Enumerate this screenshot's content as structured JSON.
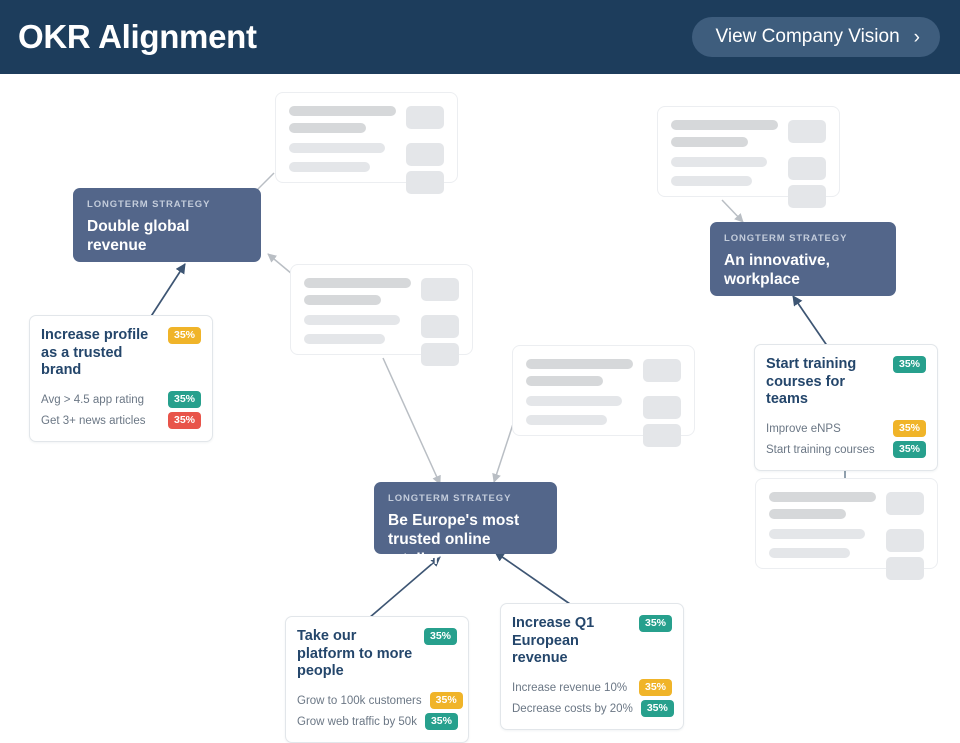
{
  "header": {
    "title": "OKR Alignment",
    "vision_button_label": "View Company Vision",
    "chevron": "›",
    "background": "#1d3d5c",
    "button_background": "#3e5d7d"
  },
  "colors": {
    "strategy_card": "#53668a",
    "okr_title": "#24466b",
    "badge_teal": "#27a08d",
    "badge_amber": "#f0b429",
    "badge_red": "#e8544a",
    "connector_grey": "#b9bec4",
    "connector_navy": "#3d5573"
  },
  "strategy_kicker": "LONGTERM STRATEGY",
  "strategies": [
    {
      "kicker": "LONGTERM STRATEGY",
      "title": "Double global revenue"
    },
    {
      "kicker": "LONGTERM STRATEGY",
      "title": "Be Europe's most trusted online retailer"
    },
    {
      "kicker": "LONGTERM STRATEGY",
      "title": "An innovative, workplace"
    }
  ],
  "okrs": [
    {
      "title": "Increase profile as a trusted brand",
      "progress": "35%",
      "progress_color": "amber",
      "key_results": [
        {
          "label": "Avg > 4.5 app rating",
          "progress": "35%",
          "color": "teal"
        },
        {
          "label": "Get 3+ news articles",
          "progress": "35%",
          "color": "red"
        }
      ]
    },
    {
      "title": "Start training courses for teams",
      "progress": "35%",
      "progress_color": "teal",
      "key_results": [
        {
          "label": "Improve eNPS",
          "progress": "35%",
          "color": "amber"
        },
        {
          "label": "Start training courses",
          "progress": "35%",
          "color": "teal"
        }
      ]
    },
    {
      "title": "Take our platform to more people",
      "progress": "35%",
      "progress_color": "teal",
      "key_results": [
        {
          "label": "Grow to 100k customers",
          "progress": "35%",
          "color": "amber"
        },
        {
          "label": "Grow web traffic by 50k",
          "progress": "35%",
          "color": "teal"
        }
      ]
    },
    {
      "title": "Increase Q1 European revenue",
      "progress": "35%",
      "progress_color": "teal",
      "key_results": [
        {
          "label": "Increase revenue 10%",
          "progress": "35%",
          "color": "amber"
        },
        {
          "label": "Decrease costs by 20%",
          "progress": "35%",
          "color": "teal"
        }
      ]
    }
  ],
  "placeholder_cards": 5
}
